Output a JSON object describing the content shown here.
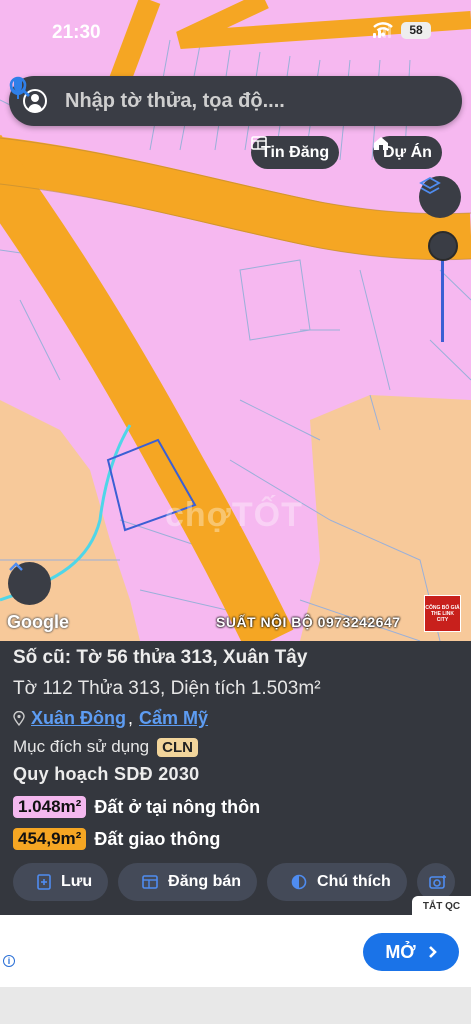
{
  "status_bar": {
    "time": "21:30",
    "battery": "58"
  },
  "search": {
    "placeholder": "Nhập tờ thửa, tọa độ...."
  },
  "chips": {
    "tin_dang": "Tin Đăng",
    "du_an": "Dự Án"
  },
  "map": {
    "google_label": "Google",
    "watermark": "chợTỐT",
    "hotline": "SUẤT NỘI BỘ 0973242647",
    "logo_text": "CÔNG BỐ GIÁ THE LINK CITY"
  },
  "parcel": {
    "old_info": "Số cũ: Tờ 56 thửa 313, Xuân Tây",
    "info": "Tờ 112 Thửa 313, Diện tích 1.503m²",
    "location_parts": [
      "Xuân Đông",
      "Cẩm Mỹ"
    ],
    "location_separator": ",",
    "purpose_label": "Mục đích sử dụng",
    "purpose_code": "CLN",
    "planning_title": "Quy hoạch SDĐ 2030",
    "planning": [
      {
        "area": "1.048m²",
        "label": "Đất ở tại nông thôn",
        "color": "#f4b8ef"
      },
      {
        "area": "454,9m²",
        "label": "Đất giao thông",
        "color": "#f5a623"
      }
    ]
  },
  "actions": {
    "save": "Lưu",
    "post": "Đăng bán",
    "legend": "Chú thích"
  },
  "ad": {
    "close_label": "TẮT QC",
    "cta": "MỞ"
  },
  "colors": {
    "land": "#f6b8f0",
    "road": "#f5a623",
    "panel": "#34373e",
    "link": "#5d9cf2",
    "cta": "#1a73e8"
  }
}
